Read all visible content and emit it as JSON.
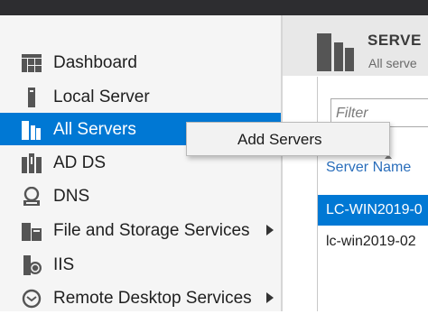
{
  "sidebar": {
    "items": [
      {
        "label": "Dashboard",
        "icon": "dashboard-icon",
        "selected": false,
        "has_submenu": false
      },
      {
        "label": "Local Server",
        "icon": "local-server-icon",
        "selected": false,
        "has_submenu": false
      },
      {
        "label": "All Servers",
        "icon": "all-servers-icon",
        "selected": true,
        "has_submenu": false
      },
      {
        "label": "AD DS",
        "icon": "ad-ds-icon",
        "selected": false,
        "has_submenu": false
      },
      {
        "label": "DNS",
        "icon": "dns-icon",
        "selected": false,
        "has_submenu": false
      },
      {
        "label": "File and Storage Services",
        "icon": "file-storage-icon",
        "selected": false,
        "has_submenu": true
      },
      {
        "label": "IIS",
        "icon": "iis-icon",
        "selected": false,
        "has_submenu": false
      },
      {
        "label": "Remote Desktop Services",
        "icon": "remote-desktop-icon",
        "selected": false,
        "has_submenu": true
      }
    ]
  },
  "context_menu": {
    "items": [
      "Add Servers"
    ]
  },
  "main": {
    "title": "SERVE",
    "subtitle": "All serve",
    "filter_placeholder": "Filter",
    "column_header": "Server Name",
    "rows": [
      {
        "name": "LC-WIN2019-0",
        "selected": true
      },
      {
        "name": "lc-win2019-02",
        "selected": false
      }
    ]
  },
  "colors": {
    "accent": "#0078d4",
    "sidebar_bg": "#f5f5f5",
    "topbar": "#2d2d30",
    "link": "#2a6ebb"
  }
}
